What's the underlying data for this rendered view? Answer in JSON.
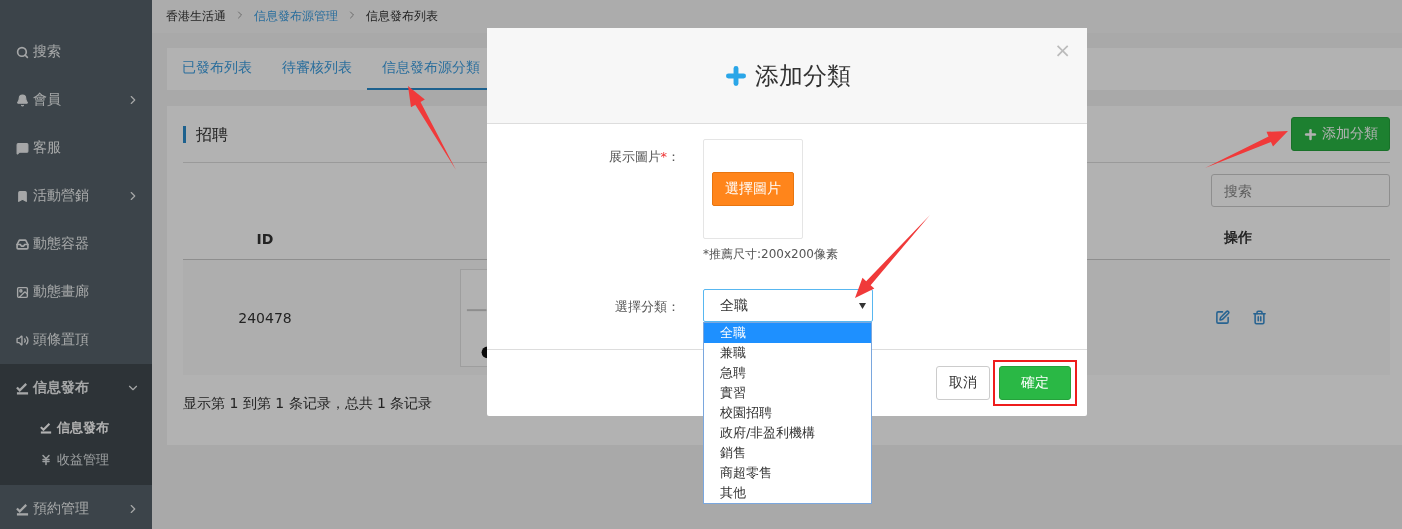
{
  "sidebar": {
    "items": [
      {
        "label": "搜索",
        "kind": "link"
      },
      {
        "label": "會員",
        "kind": "group",
        "expanded": false
      },
      {
        "label": "客服",
        "kind": "link"
      },
      {
        "label": "活動營銷",
        "kind": "group",
        "expanded": false
      },
      {
        "label": "動態容器",
        "kind": "link"
      },
      {
        "label": "動態畫廊",
        "kind": "link"
      },
      {
        "label": "頭條置頂",
        "kind": "link"
      },
      {
        "label": "信息發布",
        "kind": "group",
        "expanded": true,
        "children": [
          {
            "label": "信息發布",
            "selected": true
          },
          {
            "label": "收益管理",
            "selected": false
          }
        ]
      },
      {
        "label": "預約管理",
        "kind": "group",
        "expanded": false
      }
    ]
  },
  "breadcrumb": [
    {
      "label": "香港生活通",
      "link": false
    },
    {
      "label": "信息發布源管理",
      "link": true
    },
    {
      "label": "信息發布列表",
      "link": false
    }
  ],
  "tabs": [
    {
      "label": "已發布列表",
      "selected": false
    },
    {
      "label": "待審核列表",
      "selected": false
    },
    {
      "label": "信息發布源分類",
      "selected": true
    }
  ],
  "panel": {
    "title": "招聘",
    "add_button": "添加分類",
    "search": {
      "placeholder": "搜索"
    },
    "table": {
      "columns": [
        "ID",
        "操作"
      ],
      "rows": [
        {
          "id": "240478"
        }
      ]
    },
    "footer": "显示第 1 到第 1 条记录，总共 1 条记录"
  },
  "modal": {
    "title": "添加分類",
    "close": "×",
    "image_field": {
      "label": "展示圖片",
      "required_mark": "*",
      "suffix": "：",
      "button": "選擇圖片",
      "hint": "*推薦尺寸:200x200像素"
    },
    "category_field": {
      "label": "選擇分類：",
      "value": "全職",
      "expanded": true,
      "options": [
        {
          "label": "全職",
          "selected": true
        },
        {
          "label": "兼職",
          "selected": false
        },
        {
          "label": "急聘",
          "selected": false
        },
        {
          "label": "實習",
          "selected": false
        },
        {
          "label": "校園招聘",
          "selected": false
        },
        {
          "label": "政府/非盈利機構",
          "selected": false
        },
        {
          "label": "銷售",
          "selected": false
        },
        {
          "label": "商超零售",
          "selected": false
        },
        {
          "label": "其他",
          "selected": false
        }
      ]
    },
    "buttons": [
      {
        "label": "取消",
        "kind": "cancel"
      },
      {
        "label": "確定",
        "kind": "confirm",
        "highlighted": true
      }
    ]
  }
}
